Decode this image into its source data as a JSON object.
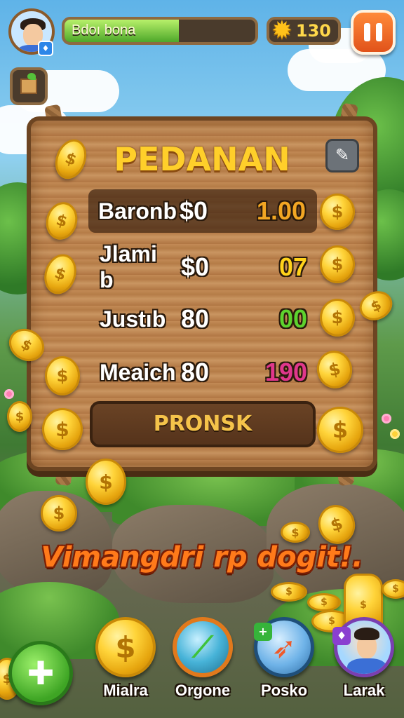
{
  "hud": {
    "player_name": "Bdoı bona",
    "progress_fraction": 0.6,
    "coin_count": "130",
    "pause_icon": "pause-icon",
    "shop_icon": "shop-box-icon"
  },
  "board": {
    "title": "PEDANAN",
    "corner_icon": "tool-icon",
    "rows": [
      {
        "name": "Baronb",
        "amount": "$0",
        "score": "1.00",
        "score_color": "#f2a623"
      },
      {
        "name": "Jlami b",
        "amount": "$0",
        "score": "07",
        "score_color": "#ffd21a"
      },
      {
        "name": "Justıb",
        "amount": "80",
        "score": "00",
        "score_color": "#5dd22e"
      },
      {
        "name": "Meaich",
        "amount": "80",
        "score": "190",
        "score_color": "#e0378c"
      }
    ],
    "action_label": "PRONSK"
  },
  "banner_text": "Vimangdri rp dogit!.",
  "nav": {
    "home_icon": "puzzle-icon",
    "items": [
      {
        "label": "Mialra",
        "icon": "coin-icon"
      },
      {
        "label": "Orgone",
        "icon": "compass-icon"
      },
      {
        "label": "Posko",
        "icon": "rocket-icon"
      },
      {
        "label": "Larak",
        "icon": "profile-avatar-icon"
      }
    ]
  }
}
